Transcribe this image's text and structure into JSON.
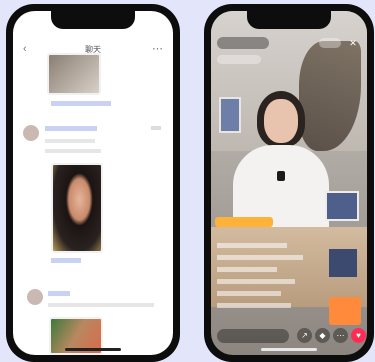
{
  "left_phone": {
    "header": {
      "back_icon": "chevron-left-icon",
      "title": "聊天",
      "more_icon": "more-icon"
    },
    "messages": [
      {
        "sender": "",
        "caption": "",
        "time": ""
      },
      {
        "sender": "",
        "caption": "",
        "time": ""
      },
      {
        "sender": "",
        "caption": "",
        "time": ""
      }
    ]
  },
  "right_phone": {
    "live": {
      "status": "",
      "comment_placeholder": ""
    },
    "icons": [
      "close-icon",
      "share-icon",
      "gift-icon",
      "heart-icon"
    ],
    "colors": {
      "accent": "#ff2d55",
      "highlight": "#ffb23a"
    }
  }
}
